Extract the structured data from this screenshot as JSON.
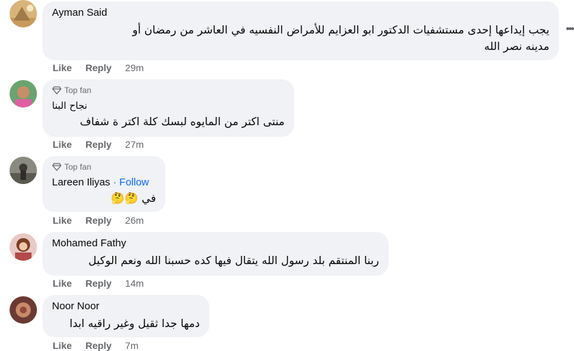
{
  "comments": [
    {
      "author": "Ayman Said",
      "text_line1": "يجب إيداعها إحدى مستشفيات الدكتور ابو العزايم للأمراض النفسيه في العاشر من رمضان أو",
      "text_line2": "مدينه نصر الله",
      "like": "Like",
      "reply": "Reply",
      "time": "29m"
    },
    {
      "badge": "Top fan",
      "author": "نجاح البنا",
      "text": "منتى اكتر من المايوه لبسك كلة اكتر ة شفاف",
      "like": "Like",
      "reply": "Reply",
      "time": "27m"
    },
    {
      "badge": "Top fan",
      "author": "Lareen Iliyas",
      "separator": "·",
      "follow": "Follow",
      "text": "في 🤔🤔",
      "like": "Like",
      "reply": "Reply",
      "time": "26m"
    },
    {
      "author": "Mohamed Fathy",
      "text": "ربنا المنتقم بلد رسول الله يتقال فيها كده حسبنا الله ونعم الوكيل",
      "like": "Like",
      "reply": "Reply",
      "time": "14m"
    },
    {
      "author": "Noor Noor",
      "text": "دمها جدا ثقيل وغير راقيه ابدا",
      "like": "Like",
      "reply": "Reply",
      "time": "7m"
    }
  ],
  "icons": {
    "more": "more-options-icon",
    "badge": "diamond-icon"
  },
  "colors": {
    "bubble": "#f0f2f5",
    "link": "#0866ff",
    "muted": "#65676b"
  }
}
